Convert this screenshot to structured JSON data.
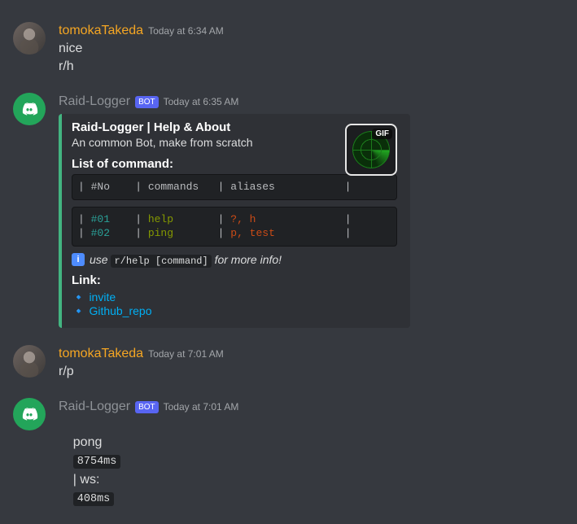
{
  "users": {
    "tomoka": "tomokaTakeda",
    "bot": "Raid-Logger"
  },
  "bot_tag": "BOT",
  "messages": {
    "m1": {
      "ts": "Today at 6:34 AM",
      "lines": [
        "nice",
        "r/h"
      ]
    },
    "m2": {
      "ts": "Today at 6:35 AM"
    },
    "m3": {
      "ts": "Today at 7:01 AM",
      "line": "r/p"
    },
    "m4": {
      "ts": "Today at 7:01 AM",
      "pong_prefix": "pong",
      "pong_lat": "8754ms",
      "pong_mid": "| ws:",
      "pong_ws": "408ms"
    }
  },
  "embed": {
    "accent": "#43b581",
    "title": "Raid-Logger | Help & About",
    "desc": "An common Bot, make from scratch",
    "gif_label": "GIF",
    "field_cmds_title": "List of command:",
    "code_header": "| #No    | commands   | aliases           |",
    "code_rows": [
      {
        "no": "#01",
        "cmd": "help",
        "alias": "?, h"
      },
      {
        "no": "#02",
        "cmd": "ping",
        "alias": "p, test"
      }
    ],
    "info_text_pre": "use",
    "info_code": "r/help [command]",
    "info_text_post": "for more info!",
    "link_title": "Link:",
    "links": [
      {
        "label": "invite"
      },
      {
        "label": "Github_repo"
      }
    ]
  }
}
